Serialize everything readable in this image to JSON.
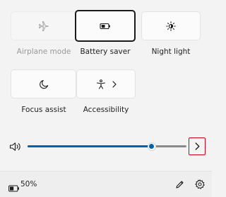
{
  "quick_settings": {
    "tiles": [
      {
        "label": "Airplane mode",
        "icon": "airplane-icon",
        "state": "disabled"
      },
      {
        "label": "Battery saver",
        "icon": "battery-saver-icon",
        "state": "selected"
      },
      {
        "label": "Night light",
        "icon": "brightness-icon",
        "state": "off"
      },
      {
        "label": "Focus assist",
        "icon": "moon-icon",
        "state": "off"
      },
      {
        "label": "Accessibility",
        "icon": "accessibility-icon",
        "state": "off",
        "has_chevron": true
      }
    ]
  },
  "volume": {
    "icon": "speaker-icon",
    "level_fraction": 0.78,
    "output_button_icon": "chevron-right-icon"
  },
  "footer": {
    "battery_icon": "battery-icon",
    "battery_text": "50%",
    "edit_icon": "pencil-icon",
    "settings_icon": "gear-icon"
  },
  "colors": {
    "background": "#f3f3f3",
    "accent": "#0063b1",
    "highlight_box": "#d0021b",
    "disabled_text": "#9a9a9a"
  }
}
